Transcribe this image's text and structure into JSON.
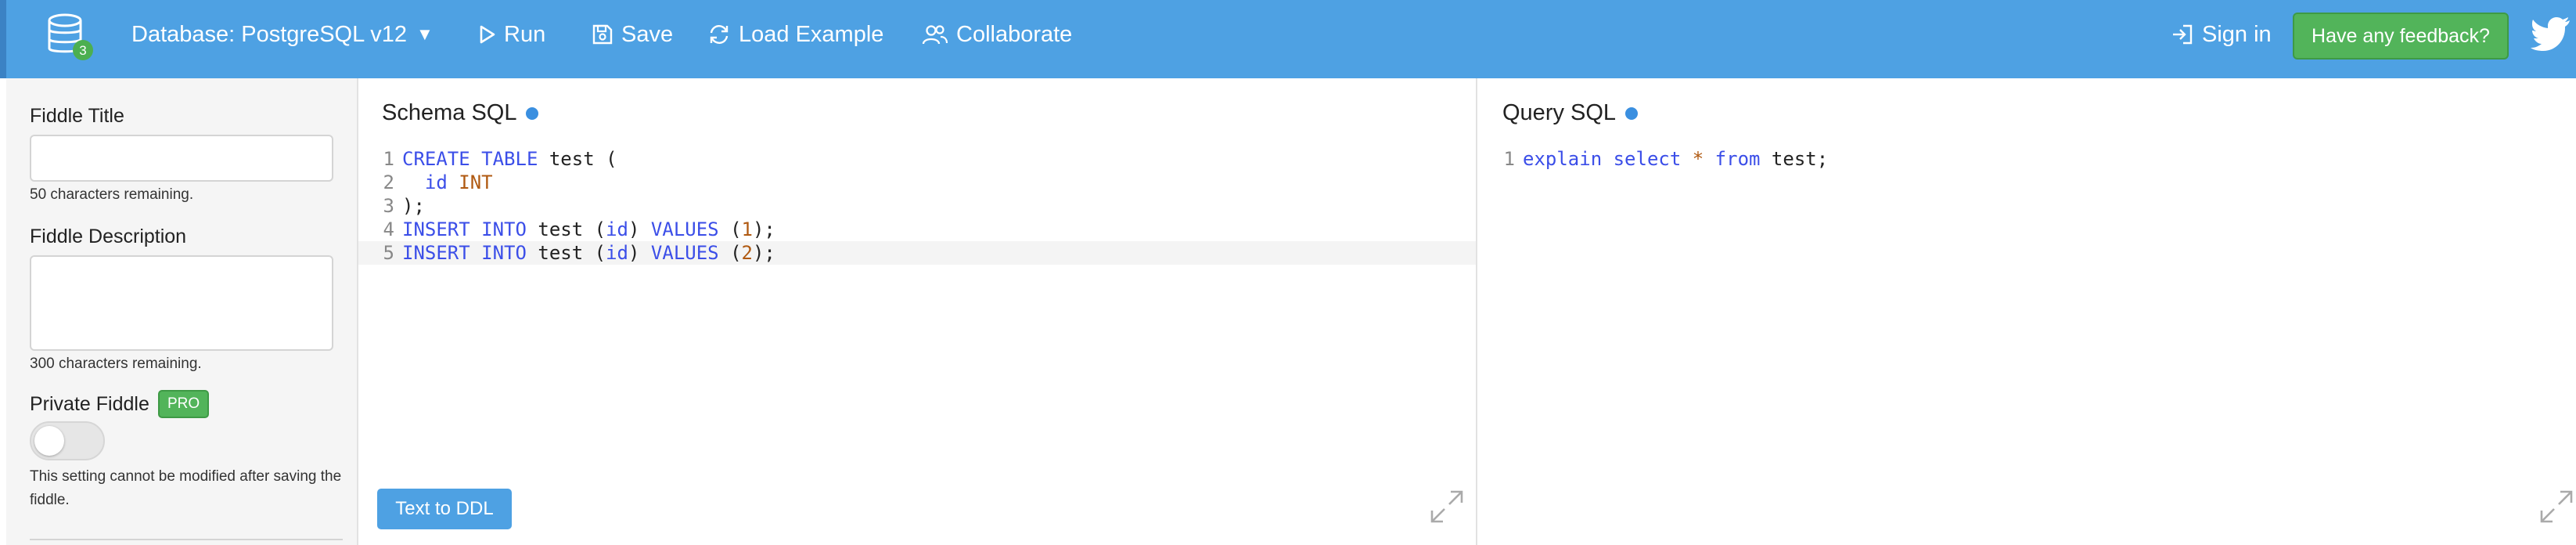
{
  "header": {
    "db_badge_count": "3",
    "database_label": "Database: PostgreSQL v12",
    "run_label": "Run",
    "save_label": "Save",
    "load_example_label": "Load Example",
    "collaborate_label": "Collaborate",
    "sign_in_label": "Sign in",
    "feedback_label": "Have any feedback?"
  },
  "sidebar": {
    "title_label": "Fiddle Title",
    "title_value": "",
    "title_hint": "50 characters remaining.",
    "description_label": "Fiddle Description",
    "description_value": "",
    "description_hint": "300 characters remaining.",
    "private_label": "Private Fiddle",
    "pro_badge": "PRO",
    "private_note": "This setting cannot be modified after saving the fiddle."
  },
  "schema": {
    "title": "Schema SQL",
    "ddl_button": "Text to DDL",
    "lines": [
      "1",
      "2",
      "3",
      "4",
      "5"
    ]
  },
  "query": {
    "title": "Query SQL",
    "lines": [
      "1"
    ]
  },
  "colors": {
    "header_bg": "#4ea1e3",
    "feedback_bg": "#52b45a",
    "keyword": "#3b4ee8",
    "type": "#b05a12"
  }
}
